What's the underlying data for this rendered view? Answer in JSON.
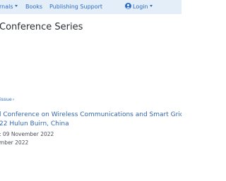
{
  "nav": {
    "journals": "rnals",
    "books": "Books",
    "publishing_support": "Publishing Support",
    "login": "Login"
  },
  "page": {
    "series_title": "Conference Series"
  },
  "breadcrumb": {
    "item": "issue"
  },
  "conference": {
    "title_line1": "l Conference on Wireless Communications and Smart Grid (IC",
    "title_line2": "22 Hulun Buirn, China",
    "date_line1": ": 09 November 2022",
    "date_line2": "mber 2022"
  },
  "colors": {
    "nav_bg": "#e4eef8",
    "link": "#2d6bc2",
    "heading": "#2b2f36",
    "muted": "#4a4f57"
  }
}
